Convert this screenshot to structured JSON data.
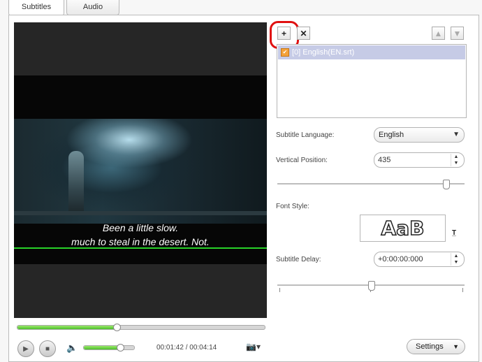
{
  "tabs": [
    {
      "label": "Subtitles",
      "active": true
    },
    {
      "label": "Audio",
      "active": false
    }
  ],
  "video": {
    "subtitle_lines": [
      "Been a little slow.",
      "much to steal in the desert. Not."
    ],
    "current_time": "00:01:42",
    "total_time": "00:04:14",
    "time_display": "00:01:42 / 00:04:14",
    "progress_fraction": 0.4,
    "volume_fraction": 0.72
  },
  "subtitle_list": {
    "items": [
      {
        "label": "[0] English(EN.srt)",
        "checked": true,
        "selected": true
      }
    ]
  },
  "toolbar": {
    "add_icon": "plus-icon",
    "remove_icon": "close-icon",
    "up_icon": "arrow-up-icon",
    "down_icon": "arrow-down-icon"
  },
  "form": {
    "language_label": "Subtitle Language:",
    "language_value": "English",
    "vertical_position_label": "Vertical Position:",
    "vertical_position_value": "435",
    "vertical_position_fraction": 0.9,
    "font_style_label": "Font Style:",
    "font_preview_text": "AaB",
    "delay_label": "Subtitle Delay:",
    "delay_value": "+0:00:00:000",
    "delay_fraction": 0.5
  },
  "settings_label": "Settings",
  "colors": {
    "highlight_ring": "#e01010",
    "progress_green": "#4cbf2b",
    "selected_row": "#c6cbe6",
    "checkbox_orange": "#f4a23a"
  }
}
